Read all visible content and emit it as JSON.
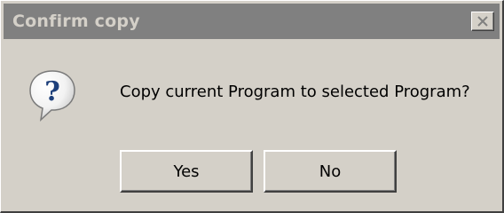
{
  "dialog": {
    "title": "Confirm copy",
    "close_icon": "close-icon",
    "icon": "question-icon",
    "message": "Copy current Program to selected Program?"
  },
  "buttons": {
    "yes_label": "Yes",
    "no_label": "No"
  },
  "colors": {
    "face": "#d4d0c8",
    "titlebar_inactive": "#808080",
    "icon_blue": "#3d6fb8"
  }
}
